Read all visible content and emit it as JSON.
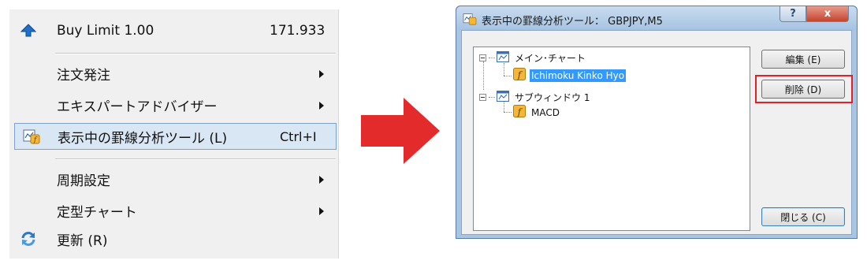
{
  "menu": {
    "items": [
      {
        "label": "Buy Limit 1.00",
        "value": "171.933",
        "icon": "up-arrow-icon"
      },
      {
        "label": "注文発注",
        "submenu": true
      },
      {
        "label": "エキスパートアドバイザー",
        "submenu": true
      },
      {
        "label": "表示中の罫線分析ツール (L)",
        "shortcut": "Ctrl+I",
        "icon": "indicator-list-icon",
        "selected": true
      },
      {
        "label": "周期設定",
        "submenu": true
      },
      {
        "label": "定型チャート",
        "submenu": true
      },
      {
        "label": "更新 (R)",
        "icon": "refresh-icon"
      }
    ]
  },
  "arrow": {
    "color": "#e32b2b"
  },
  "dialog": {
    "title": "表示中の罫線分析ツール： GBPJPY,M5",
    "help_label": "?",
    "close_label": "x",
    "tree": [
      {
        "label": "メイン･チャート",
        "children": [
          {
            "label": "Ichimoku Kinko Hyo",
            "selected": true
          }
        ]
      },
      {
        "label": "サブウィンドウ 1",
        "children": [
          {
            "label": "MACD"
          }
        ]
      }
    ],
    "buttons": {
      "edit": "編集 (E)",
      "delete": "削除 (D)",
      "close": "閉じる (C)"
    },
    "highlight_color": "#e0202a"
  }
}
